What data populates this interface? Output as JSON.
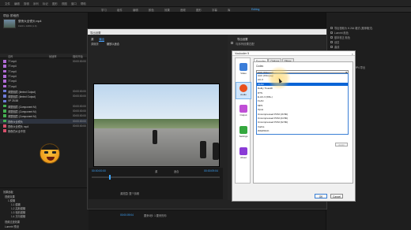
{
  "colors": {
    "accent": "#3ea6ff",
    "highlight": "#0a64d6"
  },
  "menubar": {
    "items": [
      "文件",
      "编辑",
      "剪辑",
      "序列",
      "标记",
      "图形",
      "视图",
      "窗口",
      "帮助"
    ]
  },
  "workspaces": {
    "items": [
      "学习",
      "组件",
      "编辑",
      "颜色",
      "效果",
      "音频",
      "图形",
      "字幕",
      "库",
      "Editing"
    ],
    "active_index": 9
  },
  "project": {
    "title": "项目: 阶段的",
    "clip_name": "昼夜大全镜头.mp4",
    "clip_info": "1920 x 1080 (1.0)",
    "col_name": "名称",
    "col_rate": "帧速率",
    "col_start": "媒体开始",
    "rows": [
      {
        "name": "77.mp4",
        "rate": "",
        "start": "00:00:00:00",
        "color": "#b06bd6"
      },
      {
        "name": "77.mp4",
        "rate": "",
        "start": "",
        "color": "#b06bd6"
      },
      {
        "name": "77.mp4",
        "rate": "",
        "start": "",
        "color": "#b06bd6"
      },
      {
        "name": "77.mp4",
        "rate": "",
        "start": "",
        "color": "#b06bd6"
      },
      {
        "name": "77.mp4",
        "rate": "",
        "start": "",
        "color": "#b06bd6"
      },
      {
        "name": "77.mp4",
        "rate": "",
        "start": "",
        "color": "#b06bd6"
      },
      {
        "name": "调整图层 (Ilerted Output)",
        "rate": "",
        "start": "00:00:00:00",
        "color": "#6c7bd6"
      },
      {
        "name": "调整图层 (Ilerted Output)",
        "rate": "",
        "start": "00:00:00:00",
        "color": "#6c7bd6"
      },
      {
        "name": "VP 25.58",
        "rate": "",
        "start": "",
        "color": "#6c7bd6"
      },
      {
        "name": "调整图层 (Component M)",
        "rate": "",
        "start": "00:00:00:00",
        "color": "#44b052"
      },
      {
        "name": "调整图层 (Component M)",
        "rate": "",
        "start": "00:00:00:00",
        "color": "#44b052"
      },
      {
        "name": "调整图层 (Component M)",
        "rate": "",
        "start": "00:00:00:00",
        "color": "#44b052"
      },
      {
        "name": "昼夜大全镜头",
        "rate": "",
        "start": "00:00:00:00",
        "color": "#44b052"
      },
      {
        "name": "昼夜大全镜头 mp4",
        "rate": "",
        "start": "00:00:00:00",
        "color": "#d64f6b"
      },
      {
        "name": "夜夜的大全不的",
        "rate": "",
        "start": "",
        "color": "#d64f6b"
      }
    ]
  },
  "effects": {
    "rows": [
      "效果面板",
      "视频效果",
      "1 模糊",
      "1.1 模糊",
      "1.2 高斯模糊",
      "1.3 相机模糊",
      "1.4 方向模糊",
      "视频过渡效果",
      "Lumetri 预设"
    ]
  },
  "export_dialog": {
    "title": "导出设置",
    "tabs": [
      "源",
      "输出"
    ],
    "active_tab": 1,
    "source_label": "源缩放:",
    "source_value": "缩放以适合",
    "timecode_in": "00:00:00:00",
    "range_label": "源",
    "custom_label": "适合",
    "timecode_out": "00:00:09:04",
    "range_bottom": "源范围: 整个剪辑",
    "settings_head": "导出设置",
    "match_seq": "与序列设置匹配"
  },
  "plugin": {
    "title": "Voukoder 5",
    "close": "×",
    "side": [
      {
        "label": "Video",
        "color": "#3b7dd8"
      },
      {
        "label": "Audio",
        "color": "#e8501e"
      },
      {
        "label": "Output",
        "color": "#c04fd6"
      },
      {
        "label": "Settings",
        "color": "#35a83f"
      },
      {
        "label": "About",
        "color": "#8a3bd6"
      }
    ],
    "selected_side": 1,
    "tabs": [
      "Encoder",
      "Options",
      "Filters"
    ],
    "active_tab": 0,
    "codec_label": "Codec",
    "codec_value": "AAC (FFmpeg)",
    "options": [
      "AAC (FFmpeg)",
      "AC-3",
      "ALAC",
      "Dolby TrueHD",
      "DTS",
      "E-AC-3 (DD+)",
      "FLAC",
      "MP3",
      "Opus",
      "Uncompressed PCM (16 Bit)",
      "Uncompressed PCM (24 Bit)",
      "Uncompressed PCM (32 Bit)",
      "Vorbis",
      "WAVPACK"
    ],
    "highlighted_option": 2,
    "apply": "Apply",
    "ok": "OK",
    "cancel": "Cancel"
  },
  "right_panel": {
    "lines": [
      "导出视频为 H.264 格式 (推荐格式)",
      "Lumetri 颜色",
      "基本校正 颜色",
      "创意",
      "曲线",
      "色轮 HSL 辅助",
      "晕影",
      "设置格式：H.264 MP4 导出"
    ]
  },
  "timeline": {
    "tc": "00:00:09:04",
    "label": "要来0秒: 1 要来的你"
  }
}
